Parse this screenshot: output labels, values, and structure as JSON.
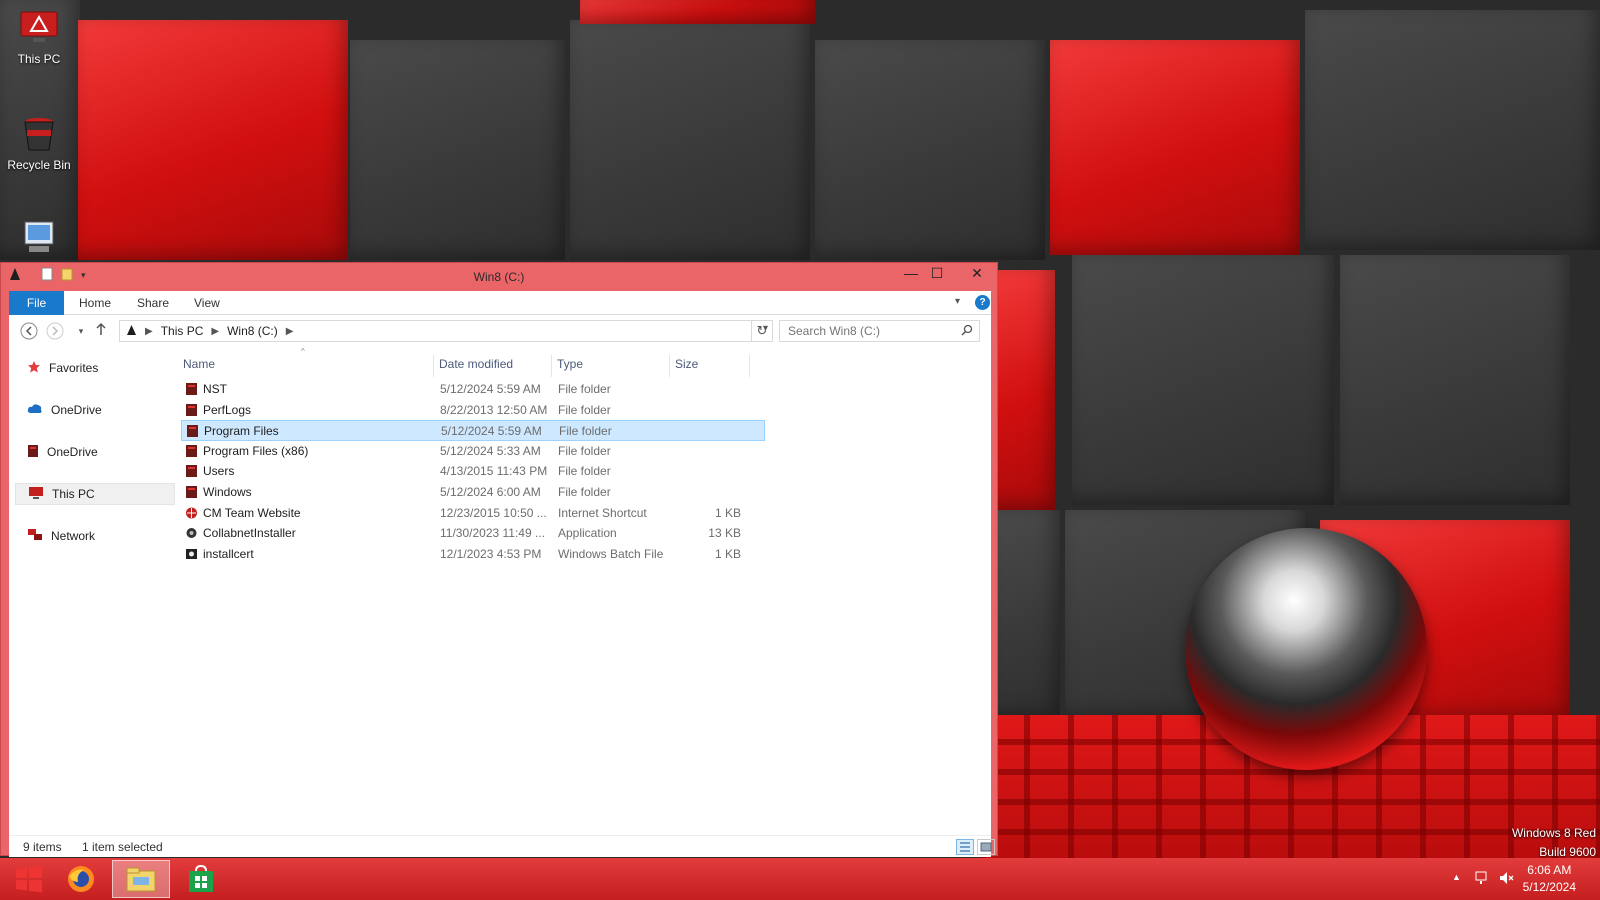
{
  "desktop": {
    "icons": [
      {
        "label": "This PC",
        "icon": "this-pc-icon"
      },
      {
        "label": "Recycle Bin",
        "icon": "recycle-bin-icon"
      },
      {
        "label": "",
        "icon": "computer-icon"
      }
    ],
    "watermark": {
      "line1": "Windows 8 Red",
      "line2": "Build 9600"
    }
  },
  "window": {
    "title": "Win8 (C:)",
    "controls": {
      "minimize": "—",
      "maximize": "☐",
      "close": "✕"
    },
    "ribbon": {
      "tabs": [
        "File",
        "Home",
        "Share",
        "View"
      ],
      "help": "?"
    },
    "address": {
      "crumbs": [
        "This PC",
        "Win8 (C:)"
      ]
    },
    "search": {
      "placeholder": "Search Win8 (C:)"
    },
    "nav_pane": [
      {
        "label": "Favorites",
        "icon": "star-icon",
        "color": "#e23c3c"
      },
      {
        "label": "OneDrive",
        "icon": "onedrive-cloud-icon",
        "color": "#1f6fc5"
      },
      {
        "label": "OneDrive",
        "icon": "onedrive-folder-icon",
        "color": "#6b1a1a"
      },
      {
        "label": "This PC",
        "icon": "this-pc-icon",
        "color": "#c21f1f",
        "selected": true
      },
      {
        "label": "Network",
        "icon": "network-icon",
        "color": "#c21f1f"
      }
    ],
    "columns": {
      "name": "Name",
      "date": "Date modified",
      "type": "Type",
      "size": "Size"
    },
    "files": [
      {
        "name": "NST",
        "date": "5/12/2024 5:59 AM",
        "type": "File folder",
        "size": "",
        "icon": "folder-icon"
      },
      {
        "name": "PerfLogs",
        "date": "8/22/2013 12:50 AM",
        "type": "File folder",
        "size": "",
        "icon": "folder-icon"
      },
      {
        "name": "Program Files",
        "date": "5/12/2024 5:59 AM",
        "type": "File folder",
        "size": "",
        "icon": "folder-icon",
        "selected": true
      },
      {
        "name": "Program Files (x86)",
        "date": "5/12/2024 5:33 AM",
        "type": "File folder",
        "size": "",
        "icon": "folder-icon"
      },
      {
        "name": "Users",
        "date": "4/13/2015 11:43 PM",
        "type": "File folder",
        "size": "",
        "icon": "folder-icon"
      },
      {
        "name": "Windows",
        "date": "5/12/2024 6:00 AM",
        "type": "File folder",
        "size": "",
        "icon": "folder-icon"
      },
      {
        "name": "CM Team Website",
        "date": "12/23/2015 10:50 ...",
        "type": "Internet Shortcut",
        "size": "1 KB",
        "icon": "internet-shortcut-icon"
      },
      {
        "name": "CollabnetInstaller",
        "date": "11/30/2023 11:49 ...",
        "type": "Application",
        "size": "13 KB",
        "icon": "application-icon"
      },
      {
        "name": "installcert",
        "date": "12/1/2023 4:53 PM",
        "type": "Windows Batch File",
        "size": "1 KB",
        "icon": "batch-file-icon"
      }
    ],
    "status": {
      "items": "9 items",
      "selected": "1 item selected"
    }
  },
  "taskbar": {
    "apps": [
      {
        "name": "start",
        "icon": "windows-start-icon"
      },
      {
        "name": "firefox",
        "icon": "firefox-icon"
      },
      {
        "name": "file-explorer",
        "icon": "file-explorer-icon",
        "active": true
      },
      {
        "name": "store",
        "icon": "store-icon"
      }
    ],
    "clock": {
      "time": "6:06 AM",
      "date": "5/12/2024"
    }
  },
  "colors": {
    "window_frame": "#e96568",
    "ribbon_file_tab": "#1979ca",
    "selection_bg": "#cde8ff",
    "selection_border": "#99d1ff",
    "taskbar": "#d42a2a"
  }
}
